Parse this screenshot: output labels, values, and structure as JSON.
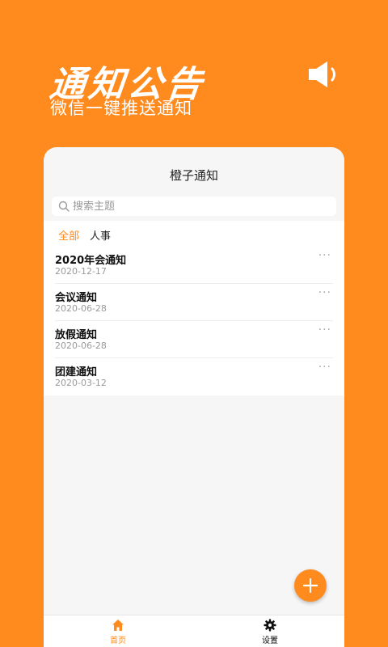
{
  "hero": {
    "title": "通知公告",
    "subtitle": "微信一键推送通知",
    "speaker_icon": "speaker-icon"
  },
  "card": {
    "title": "橙子通知",
    "search": {
      "placeholder": "搜索主题",
      "value": ""
    },
    "tabs": [
      {
        "label": "全部",
        "active": true
      },
      {
        "label": "人事",
        "active": false
      }
    ],
    "items": [
      {
        "title": "2020年会通知",
        "date": "2020-12-17",
        "more": "···"
      },
      {
        "title": "会议通知",
        "date": "2020-06-28",
        "more": "···"
      },
      {
        "title": "放假通知",
        "date": "2020-06-28",
        "more": "···"
      },
      {
        "title": "团建通知",
        "date": "2020-03-12",
        "more": "···"
      }
    ]
  },
  "fab": {
    "icon": "plus-icon"
  },
  "tabbar": {
    "items": [
      {
        "label": "首页",
        "icon": "home-icon",
        "active": true
      },
      {
        "label": "设置",
        "icon": "gear-icon",
        "active": false
      }
    ]
  },
  "colors": {
    "accent": "#FF8A1E",
    "background": "#FF8A1E",
    "card": "#F6F6F6",
    "text": "#111111",
    "muted": "#9A9A9A"
  }
}
